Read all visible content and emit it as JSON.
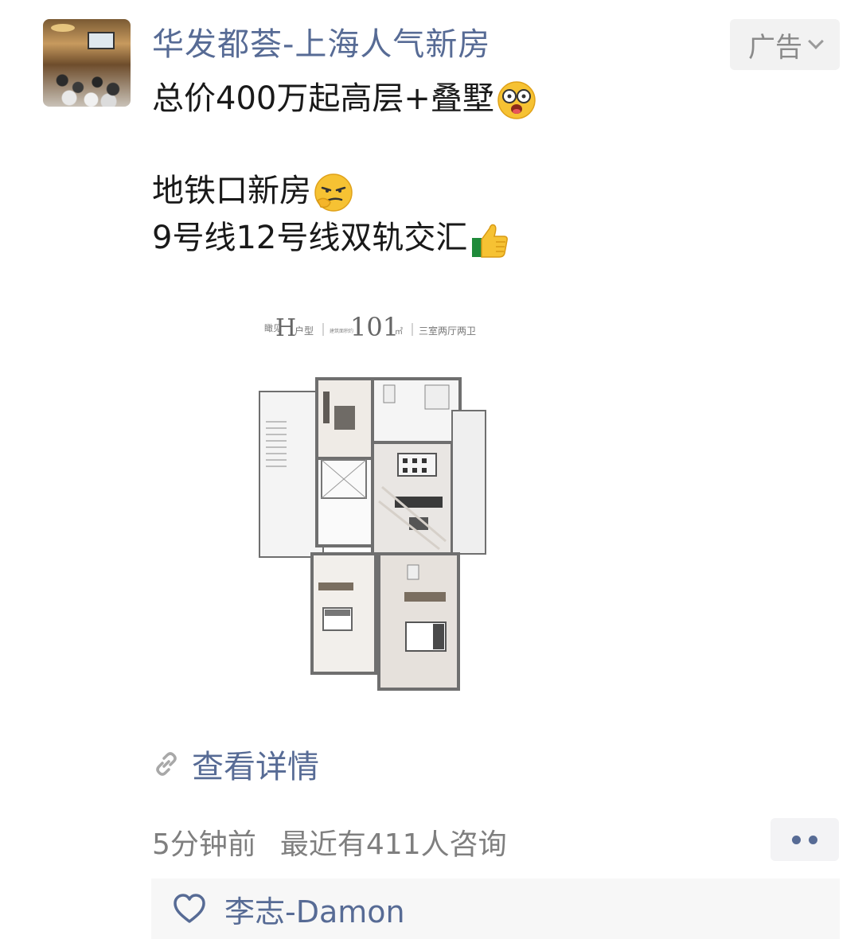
{
  "post": {
    "author": "华发都荟-上海人气新房",
    "ad_label": "广告",
    "text_line1": "总价400万起高层+叠墅",
    "text_line2": "地铁口新房",
    "text_line3": "9号线12号线双轨交汇"
  },
  "floorplan": {
    "title_text": "瞰见",
    "type_letter": "H",
    "type_suffix": "户型",
    "area_label": "建筑面积约",
    "area": "101",
    "area_unit": "㎡",
    "layout": "三室两厅两卫"
  },
  "link": {
    "label": "查看详情"
  },
  "meta": {
    "time": "5分钟前",
    "consult": "最近有411人咨询"
  },
  "likes": {
    "names": "李志-Damon"
  },
  "colors": {
    "link": "#576b95",
    "meta": "#7f7f7f",
    "likes_bg": "#f7f7f7"
  }
}
